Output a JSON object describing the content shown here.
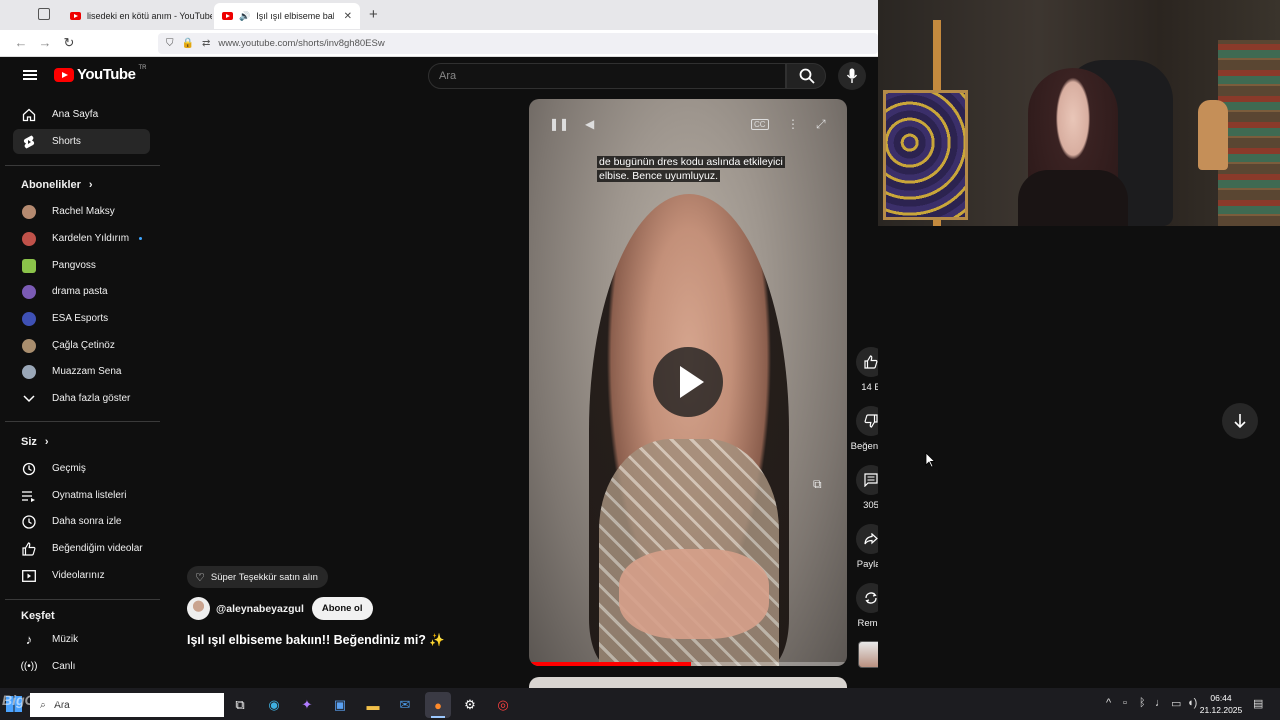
{
  "browser": {
    "tabs": [
      {
        "title": "lisedeki en kötü anım - YouTube",
        "active": false
      },
      {
        "title": "Işıl ışıl elbiseme bakıın!! Be",
        "active": true,
        "audio": true
      }
    ],
    "new_tab": "+",
    "url": "www.youtube.com/shorts/inv8gh80ESw"
  },
  "youtube": {
    "logo_text": "YouTube",
    "logo_region": "TR",
    "search_placeholder": "Ara"
  },
  "sidebar": {
    "main_items": [
      {
        "label": "Ana Sayfa",
        "icon": "home-icon"
      },
      {
        "label": "Shorts",
        "icon": "shorts-icon",
        "active": true
      }
    ],
    "subscriptions_heading": "Abonelikler",
    "subscriptions": [
      {
        "label": "Rachel Maksy",
        "color": "#b58a70"
      },
      {
        "label": "Kardelen Yıldırım",
        "color": "#c0524a",
        "new": true
      },
      {
        "label": "Pangvoss",
        "color": "#8bc34a"
      },
      {
        "label": "drama pasta",
        "color": "#7b5bb5"
      },
      {
        "label": "ESA Esports",
        "color": "#3f51b5"
      },
      {
        "label": "Çağla Çetinöz",
        "color": "#a98e6e"
      },
      {
        "label": "Muazzam Sena",
        "color": "#9aa7b8"
      }
    ],
    "show_more": "Daha fazla göster",
    "you_heading": "Siz",
    "you_items": [
      {
        "label": "Geçmiş",
        "icon": "history-icon"
      },
      {
        "label": "Oynatma listeleri",
        "icon": "playlists-icon"
      },
      {
        "label": "Daha sonra izle",
        "icon": "clock-icon"
      },
      {
        "label": "Beğendiğim videolar",
        "icon": "like-icon"
      },
      {
        "label": "Videolarınız",
        "icon": "your-videos-icon"
      }
    ],
    "explore_heading": "Keşfet",
    "explore_items": [
      {
        "label": "Müzik",
        "icon": "music-icon"
      },
      {
        "label": "Canlı",
        "icon": "live-icon"
      }
    ]
  },
  "player": {
    "caption_line1": "de bugünün dres kodu aslında etkileyici",
    "caption_line2": "elbise. Bence uyumluyuz.",
    "progress": 0.51
  },
  "actions": {
    "like_count": "14 B",
    "dislike_label": "Beğenme",
    "comments_count": "305",
    "share_label": "Paylaş",
    "remix_label": "Remix"
  },
  "video_info": {
    "super_thanks": "Süper Teşekkür satın alın",
    "channel": "@aleynabeyazgul",
    "subscribe": "Abone ol",
    "title": "Işıl ışıl elbiseme bakıın!! Beğendiniz mi? ✨"
  },
  "taskbar": {
    "search_text": "Ara",
    "time": "06:44",
    "date": "21.12.2025",
    "watermark": "BigGame"
  }
}
